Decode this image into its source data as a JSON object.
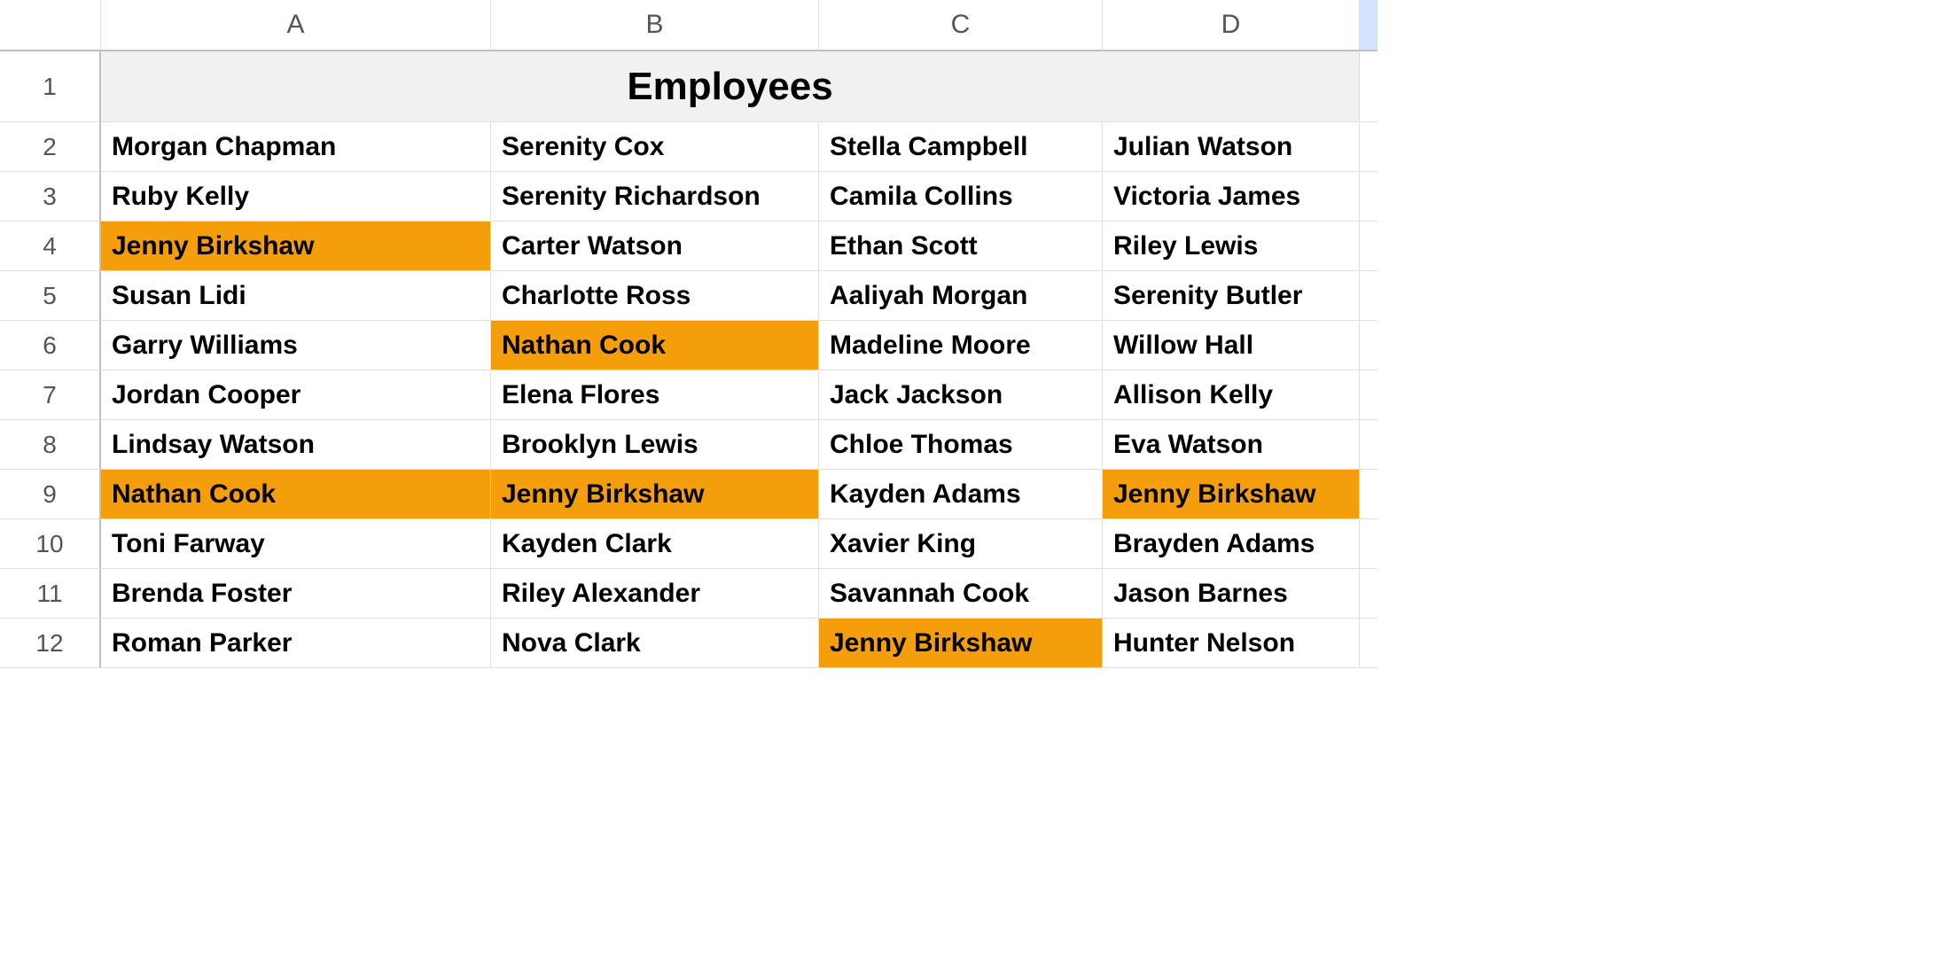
{
  "columns": [
    "A",
    "B",
    "C",
    "D"
  ],
  "rowNumbers": [
    "1",
    "2",
    "3",
    "4",
    "5",
    "6",
    "7",
    "8",
    "9",
    "10",
    "11",
    "12"
  ],
  "title": "Employees",
  "highlightColor": "#f59e0b",
  "rows": [
    {
      "num": "2",
      "cells": [
        {
          "text": "Morgan Chapman",
          "hl": false
        },
        {
          "text": "Serenity Cox",
          "hl": false
        },
        {
          "text": "Stella Campbell",
          "hl": false
        },
        {
          "text": "Julian Watson",
          "hl": false
        }
      ]
    },
    {
      "num": "3",
      "cells": [
        {
          "text": "Ruby Kelly",
          "hl": false
        },
        {
          "text": "Serenity Richardson",
          "hl": false
        },
        {
          "text": "Camila Collins",
          "hl": false
        },
        {
          "text": "Victoria James",
          "hl": false
        }
      ]
    },
    {
      "num": "4",
      "cells": [
        {
          "text": "Jenny Birkshaw",
          "hl": true
        },
        {
          "text": "Carter Watson",
          "hl": false
        },
        {
          "text": "Ethan Scott",
          "hl": false
        },
        {
          "text": "Riley Lewis",
          "hl": false
        }
      ]
    },
    {
      "num": "5",
      "cells": [
        {
          "text": "Susan Lidi",
          "hl": false
        },
        {
          "text": "Charlotte Ross",
          "hl": false
        },
        {
          "text": "Aaliyah Morgan",
          "hl": false
        },
        {
          "text": "Serenity Butler",
          "hl": false
        }
      ]
    },
    {
      "num": "6",
      "cells": [
        {
          "text": "Garry Williams",
          "hl": false
        },
        {
          "text": "Nathan Cook",
          "hl": true
        },
        {
          "text": "Madeline Moore",
          "hl": false
        },
        {
          "text": "Willow Hall",
          "hl": false
        }
      ]
    },
    {
      "num": "7",
      "cells": [
        {
          "text": "Jordan Cooper",
          "hl": false
        },
        {
          "text": "Elena Flores",
          "hl": false
        },
        {
          "text": "Jack Jackson",
          "hl": false
        },
        {
          "text": "Allison Kelly",
          "hl": false
        }
      ]
    },
    {
      "num": "8",
      "cells": [
        {
          "text": "Lindsay Watson",
          "hl": false
        },
        {
          "text": "Brooklyn Lewis",
          "hl": false
        },
        {
          "text": "Chloe Thomas",
          "hl": false
        },
        {
          "text": "Eva Watson",
          "hl": false
        }
      ]
    },
    {
      "num": "9",
      "cells": [
        {
          "text": "Nathan Cook",
          "hl": true
        },
        {
          "text": "Jenny Birkshaw",
          "hl": true
        },
        {
          "text": "Kayden Adams",
          "hl": false
        },
        {
          "text": "Jenny Birkshaw",
          "hl": true
        }
      ]
    },
    {
      "num": "10",
      "cells": [
        {
          "text": "Toni Farway",
          "hl": false
        },
        {
          "text": "Kayden Clark",
          "hl": false
        },
        {
          "text": "Xavier King",
          "hl": false
        },
        {
          "text": "Brayden Adams",
          "hl": false
        }
      ]
    },
    {
      "num": "11",
      "cells": [
        {
          "text": "Brenda Foster",
          "hl": false
        },
        {
          "text": "Riley Alexander",
          "hl": false
        },
        {
          "text": "Savannah Cook",
          "hl": false
        },
        {
          "text": "Jason Barnes",
          "hl": false
        }
      ]
    },
    {
      "num": "12",
      "cells": [
        {
          "text": "Roman Parker",
          "hl": false
        },
        {
          "text": "Nova Clark",
          "hl": false
        },
        {
          "text": "Jenny Birkshaw",
          "hl": true
        },
        {
          "text": "Hunter Nelson",
          "hl": false
        }
      ]
    }
  ]
}
